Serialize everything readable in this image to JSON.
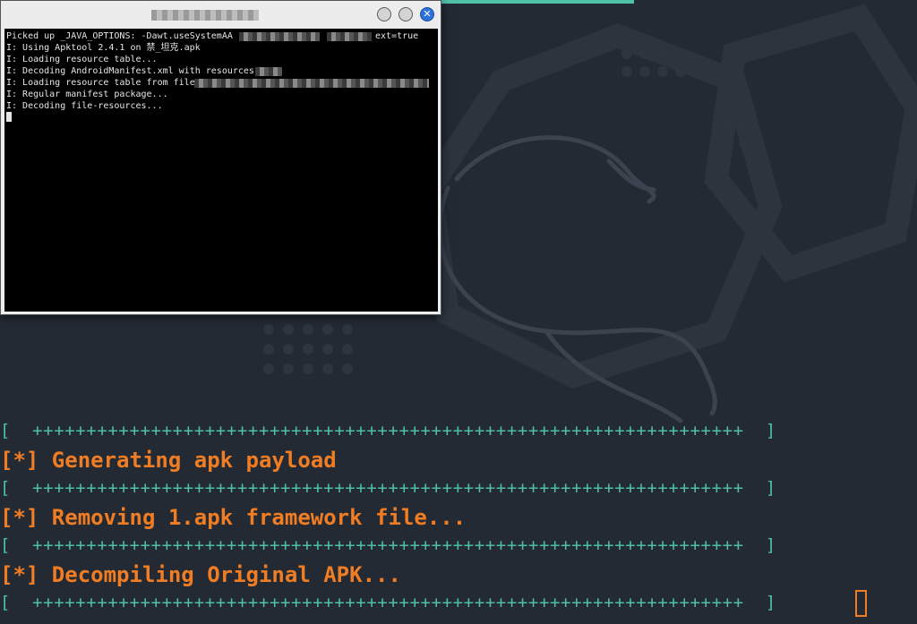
{
  "popup": {
    "title": "",
    "lines": [
      "Picked up _JAVA_OPTIONS: -Dawt.useSystemAA",
      "I: Using Apktool 2.4.1 on 禁_坦克.apk",
      "I: Loading resource table...",
      "I: Decoding AndroidManifest.xml with resources",
      "I: Loading resource table from file",
      "I: Regular manifest package...",
      "I: Decoding file-resources..."
    ],
    "line0_tail": "ext=true"
  },
  "main": {
    "separator": "[  ++++++++++++++++++++++++++++++++++++++++++++++++++++++++++++++++++  ]",
    "status_lines": [
      "[*] Generating apk payload",
      "[*] Removing 1.apk framework file...",
      "[*] Decompiling Original APK..."
    ]
  },
  "colors": {
    "background": "#232a33",
    "accent_orange": "#f07d23",
    "accent_teal": "#4fbfa5"
  },
  "icons": {
    "close": "close-icon",
    "minimize": "minimize-icon",
    "maximize": "maximize-icon"
  }
}
